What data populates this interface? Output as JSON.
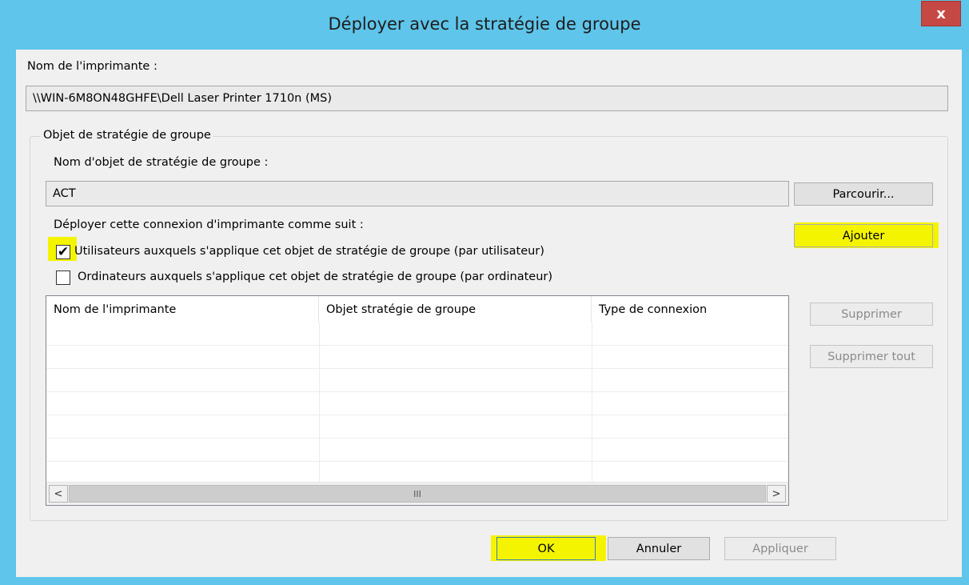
{
  "window": {
    "title": "Déployer avec la stratégie de groupe",
    "close_label": "x"
  },
  "printer_name": {
    "label": "Nom de l'imprimante :",
    "value": "\\\\WIN-6M8ON48GHFE\\Dell Laser Printer 1710n (MS)"
  },
  "gpo_group": {
    "legend": "Objet de stratégie de groupe",
    "gpo_name_label": "Nom d'objet de stratégie de groupe :",
    "gpo_name_value": "ACT",
    "browse_label": "Parcourir...",
    "deploy_label": "Déployer cette connexion d'imprimante comme suit :",
    "add_label": "Ajouter",
    "options": [
      {
        "label": "Utilisateurs auxquels s'applique cet objet de stratégie de groupe (par utilisateur)",
        "checked": true
      },
      {
        "label": "Ordinateurs auxquels s'applique cet objet de stratégie de groupe (par ordinateur)",
        "checked": false
      }
    ],
    "table": {
      "columns": [
        "Nom de l'imprimante",
        "Objet stratégie de groupe",
        "Type de connexion"
      ],
      "rows": [],
      "scroll_left": "<",
      "scroll_right": ">",
      "scroll_thumb": "III"
    },
    "remove_label": "Supprimer",
    "remove_all_label": "Supprimer tout"
  },
  "footer": {
    "ok_label": "OK",
    "cancel_label": "Annuler",
    "apply_label": "Appliquer"
  },
  "colors": {
    "titlebar": "#5fc5ea",
    "close": "#c64845",
    "highlight": "#f4f400"
  }
}
